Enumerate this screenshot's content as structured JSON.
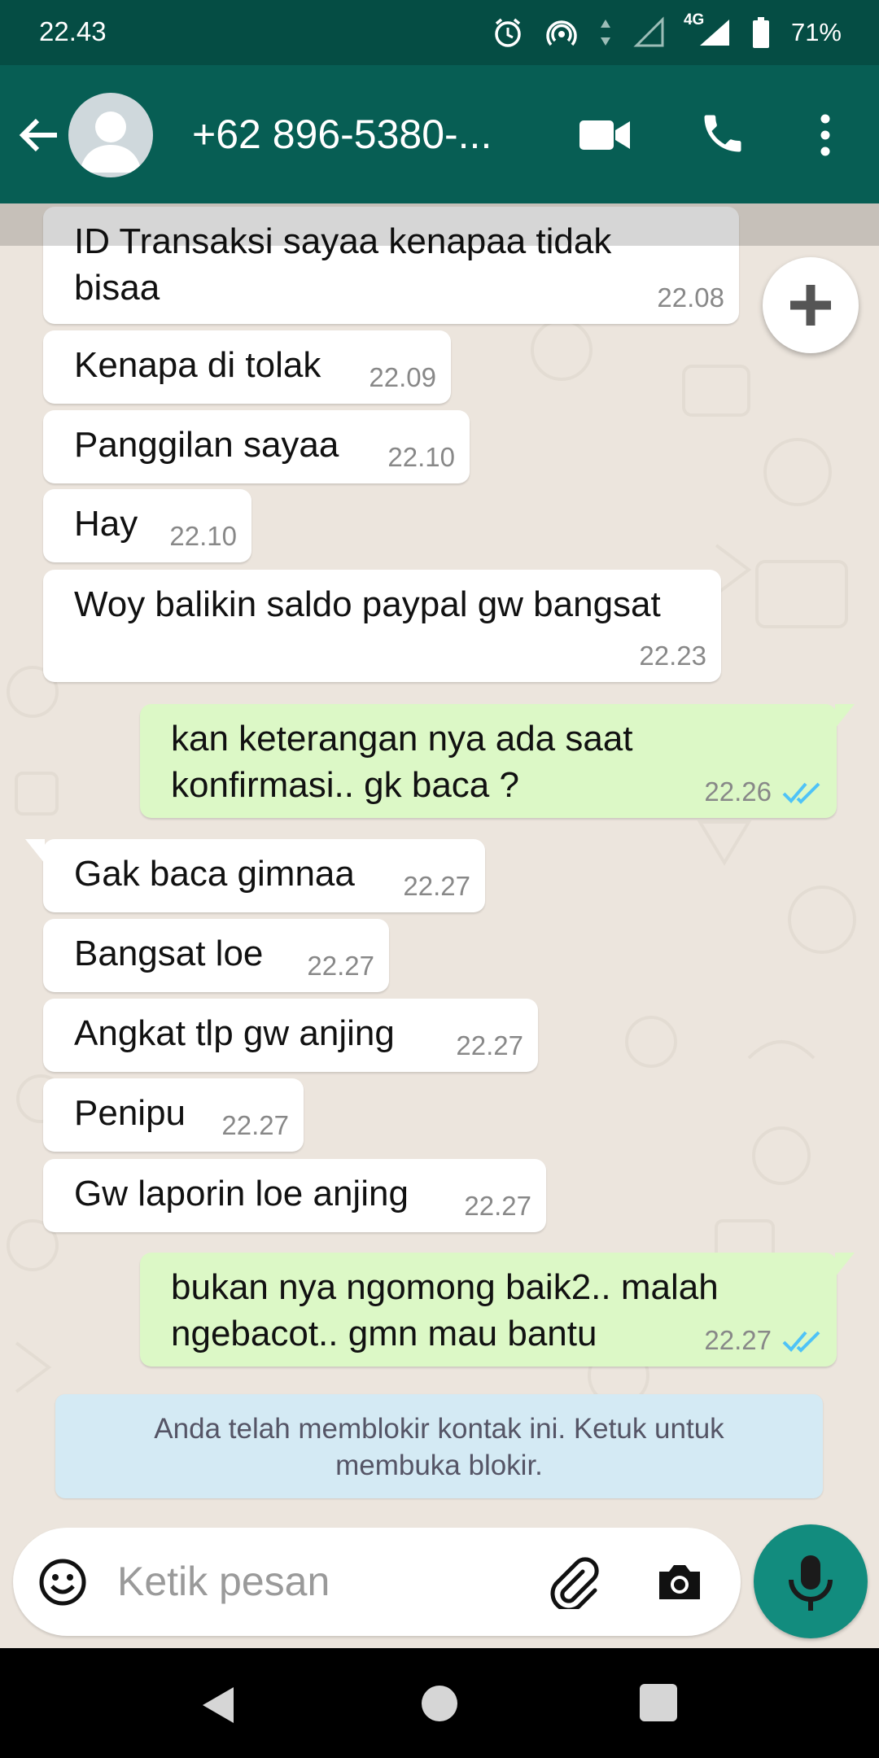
{
  "status_bar": {
    "time": "22.43",
    "network_label": "4G",
    "battery": "71%"
  },
  "header": {
    "contact_name": "+62 896-5380-..."
  },
  "messages": [
    {
      "dir": "in",
      "text_lines": [
        "ID Transaksi sayaa kenapaa tidak",
        "bisaa"
      ],
      "time": "22.08"
    },
    {
      "dir": "in",
      "text_lines": [
        "Kenapa di tolak"
      ],
      "time": "22.09"
    },
    {
      "dir": "in",
      "text_lines": [
        "Panggilan sayaa"
      ],
      "time": "22.10"
    },
    {
      "dir": "in",
      "text_lines": [
        "Hay"
      ],
      "time": "22.10"
    },
    {
      "dir": "in",
      "text_lines": [
        "Woy balikin saldo paypal gw bangsat"
      ],
      "time": "22.23"
    },
    {
      "dir": "out",
      "text_lines": [
        "kan keterangan nya ada saat",
        "konfirmasi.. gk baca ?"
      ],
      "time": "22.26",
      "read": true
    },
    {
      "dir": "in",
      "text_lines": [
        "Gak baca gimnaa"
      ],
      "time": "22.27"
    },
    {
      "dir": "in",
      "text_lines": [
        "Bangsat loe"
      ],
      "time": "22.27"
    },
    {
      "dir": "in",
      "text_lines": [
        "Angkat tlp gw anjing"
      ],
      "time": "22.27"
    },
    {
      "dir": "in",
      "text_lines": [
        "Penipu"
      ],
      "time": "22.27"
    },
    {
      "dir": "in",
      "text_lines": [
        "Gw laporin loe anjing"
      ],
      "time": "22.27"
    },
    {
      "dir": "out",
      "text_lines": [
        "bukan nya ngomong baik2.. malah",
        "ngebacot.. gmn mau bantu"
      ],
      "time": "22.27",
      "read": true
    }
  ],
  "blocked_notice": {
    "line1": "Anda telah memblokir kontak ini. Ketuk untuk",
    "line2": "membuka blokir."
  },
  "input": {
    "placeholder": "Ketik pesan"
  },
  "icons": {
    "back": "arrow-left-icon",
    "avatar": "default-avatar",
    "video": "video-camera-icon",
    "call": "phone-icon",
    "menu": "more-vertical-icon",
    "add": "plus-icon",
    "emoji": "emoji-icon",
    "attach": "paperclip-icon",
    "camera": "camera-icon",
    "mic": "microphone-icon"
  },
  "colors": {
    "status_bar": "#054d44",
    "app_bar": "#075e54",
    "chat_bg": "#ece5dd",
    "incoming_bubble": "#ffffff",
    "outgoing_bubble": "#dcf8c6",
    "read_ticks": "#4fc3f7",
    "mic_button": "#128c7e",
    "blocked_notice_bg": "#d4eaf4"
  }
}
